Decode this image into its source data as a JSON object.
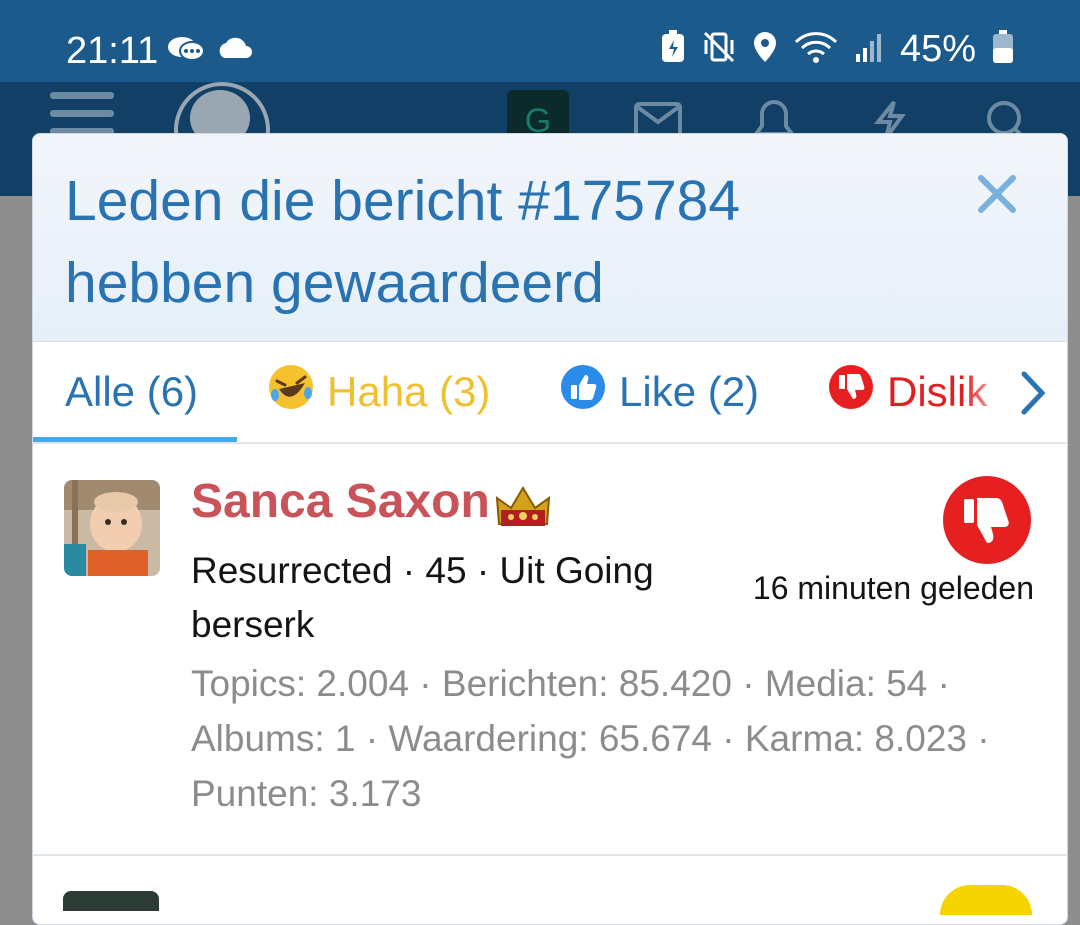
{
  "status_bar": {
    "time": "21:11",
    "battery": "45%",
    "icons": [
      "chat-bubbles-icon",
      "cloud-icon",
      "battery-saver-icon",
      "vibrate-mute-icon",
      "location-icon",
      "wifi-icon",
      "signal-icon",
      "battery-icon"
    ]
  },
  "app_header": {
    "avatar_letter": "G",
    "icons": [
      "menu-icon",
      "site-logo",
      "mail-icon",
      "bell-icon",
      "flash-icon",
      "search-icon"
    ]
  },
  "modal": {
    "title": "Leden die bericht #175784 hebben gewaardeerd",
    "close_icon": "close-icon",
    "tabs": [
      {
        "label": "Alle (6)",
        "active": true
      },
      {
        "label": "Haha (3)",
        "icon": "haha-emoji-icon",
        "color": "#f0c030"
      },
      {
        "label": "Like (2)",
        "icon": "like-icon",
        "color": "#2a73b2"
      },
      {
        "label": "Dislik",
        "icon": "dislike-icon",
        "color": "#e02020"
      }
    ],
    "member": {
      "name": "Sanca Saxon",
      "name_color": "#c8545a",
      "role": "Resurrected · 45 · Uit Going berserk",
      "stats": "Topics: 2.004 · Berichten: 85.420 · Media: 54 · Albums: 1 · Waardering: 65.674 · Karma: 8.023 · Punten: 3.173",
      "reaction": "dislike",
      "time": "16 minuten geleden"
    }
  },
  "colors": {
    "status_bar": "#1c5a8c",
    "accent": "#2a73b2",
    "tab_underline": "#47a7eb",
    "dislike": "#e02020"
  }
}
